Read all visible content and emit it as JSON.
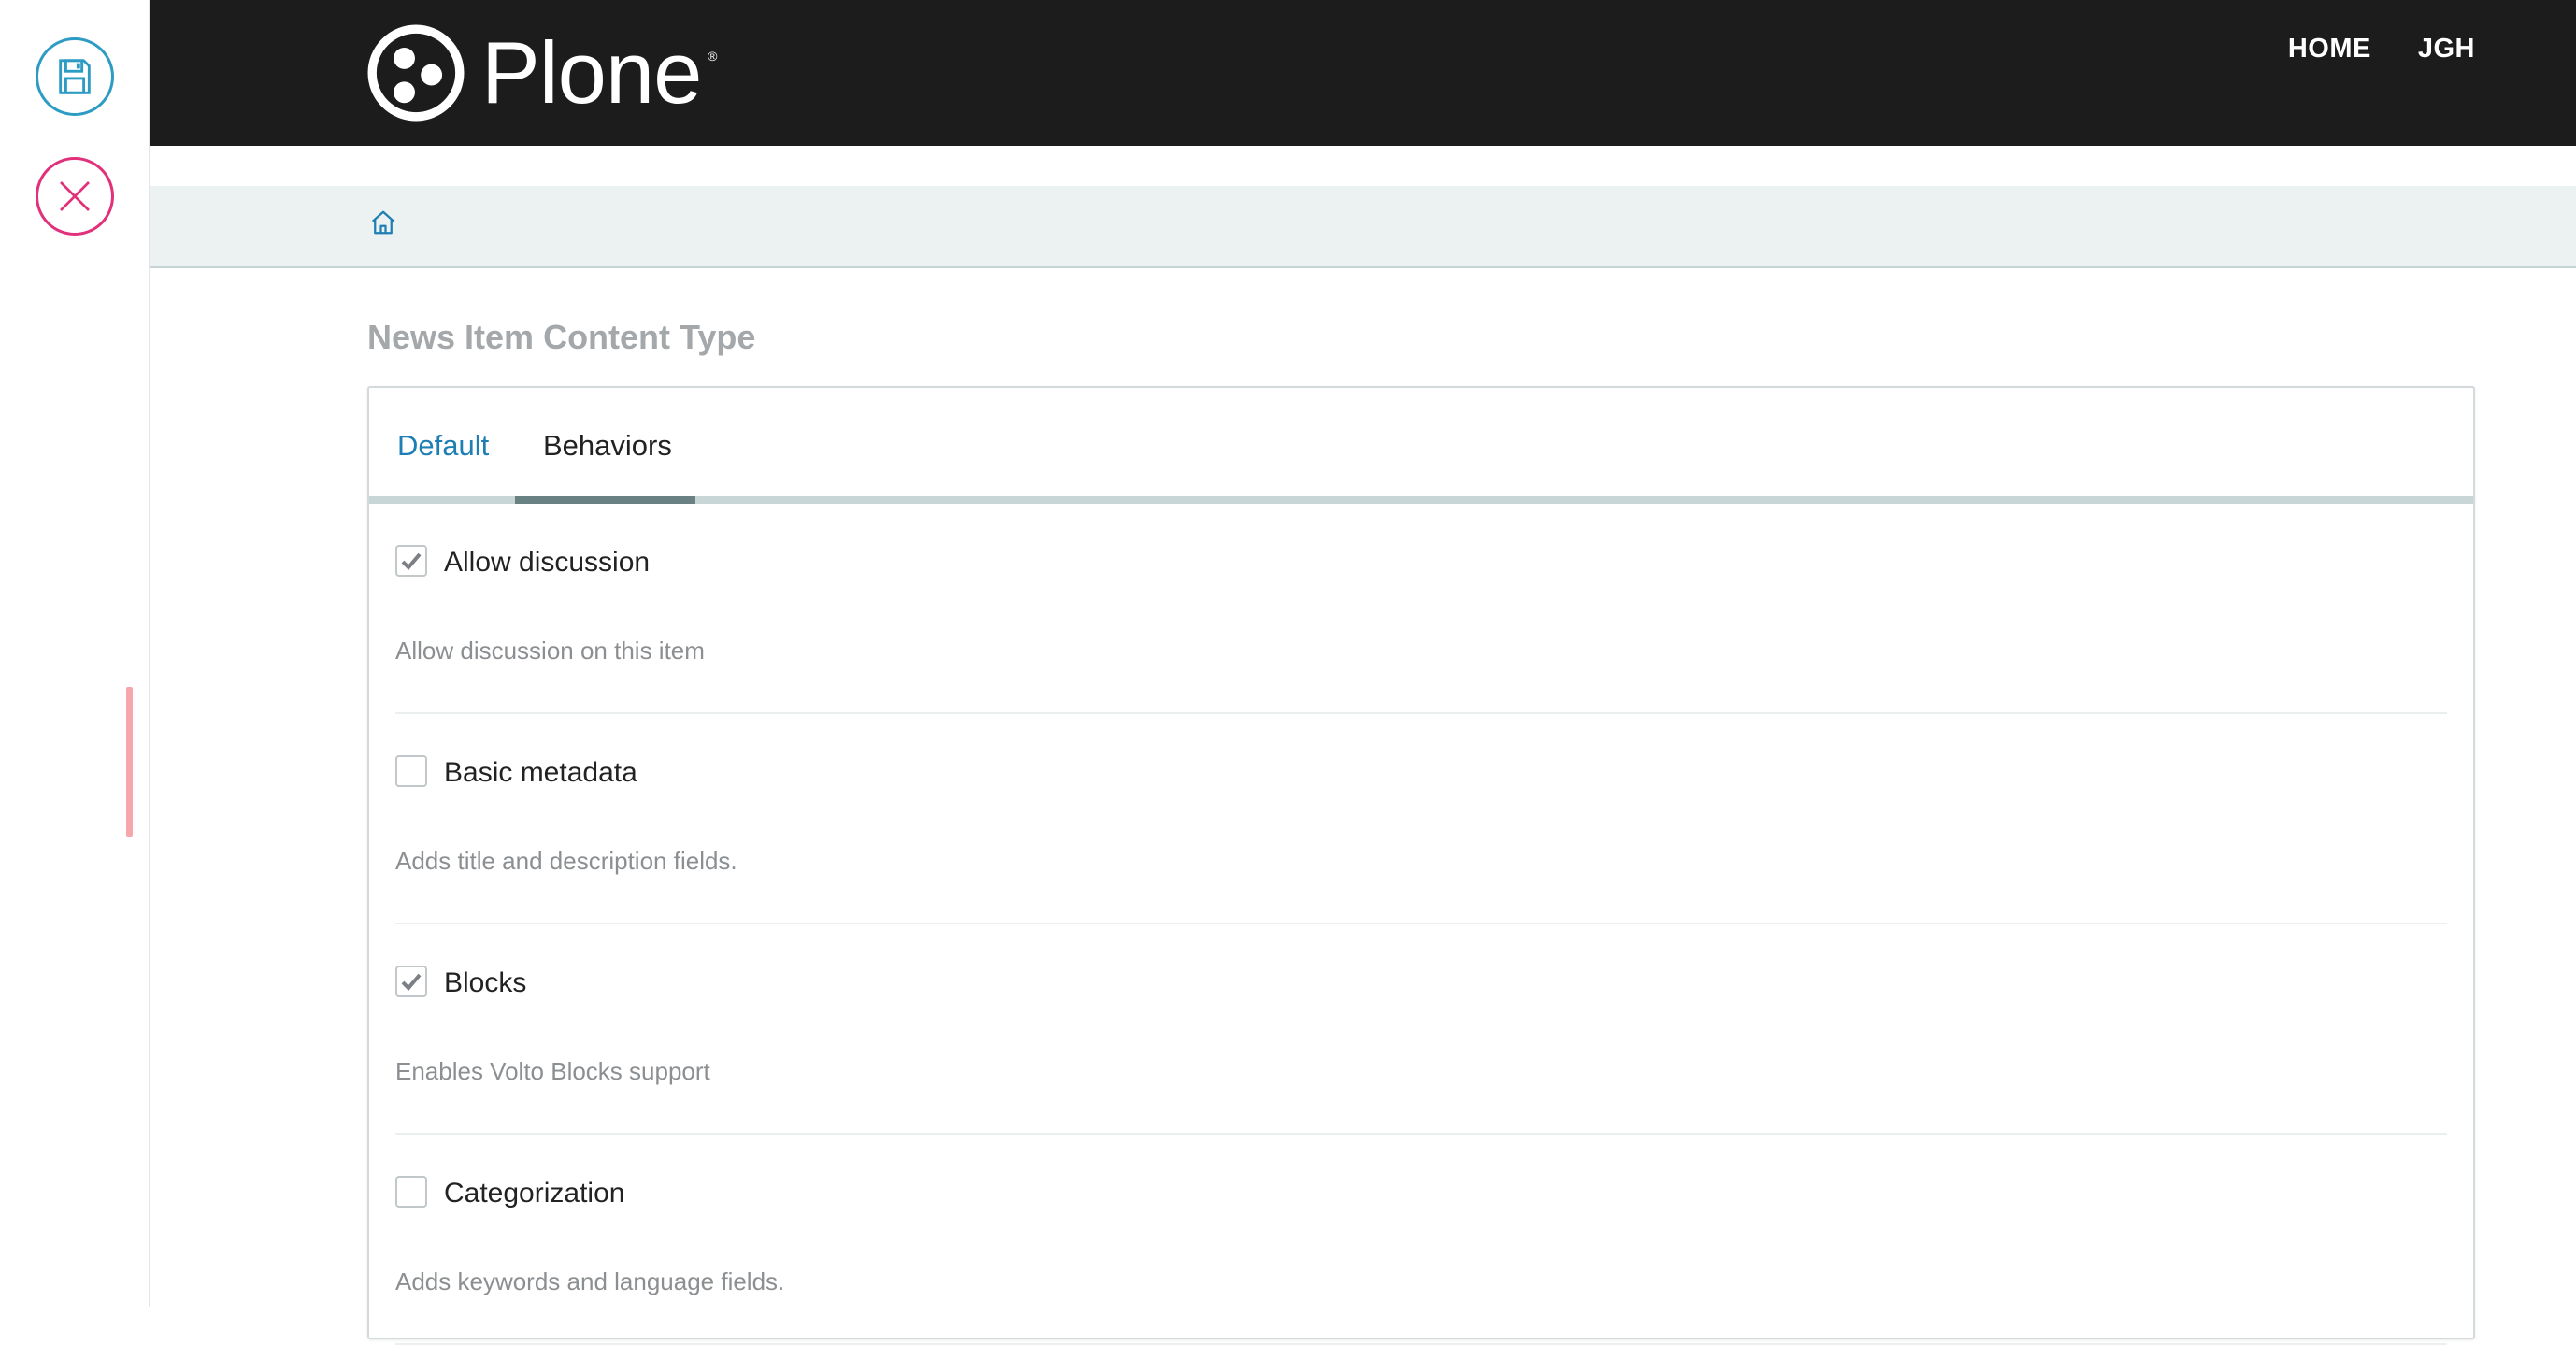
{
  "toolbar": {
    "save_icon": "floppy-disk-icon",
    "cancel_icon": "close-icon",
    "save_color": "#2d9cc4",
    "cancel_color": "#e0317a"
  },
  "header": {
    "logo_text": "Plone",
    "logo_registered": "®",
    "nav": [
      "HOME",
      "JGH"
    ]
  },
  "breadcrumbs": {
    "home_icon": "home-icon"
  },
  "page": {
    "title": "News Item Content Type"
  },
  "tabs": [
    {
      "label": "Default",
      "active": false
    },
    {
      "label": "Behaviors",
      "active": true
    }
  ],
  "behaviors": [
    {
      "label": "Allow discussion",
      "help": "Allow discussion on this item",
      "checked": true
    },
    {
      "label": "Basic metadata",
      "help": "Adds title and description fields.",
      "checked": false
    },
    {
      "label": "Blocks",
      "help": "Enables Volto Blocks support",
      "checked": true
    },
    {
      "label": "Categorization",
      "help": "Adds keywords and language fields.",
      "checked": false
    }
  ],
  "colors": {
    "header_bg": "#1c1c1c",
    "link": "#1f7fb4",
    "breadcrumb_bg": "#ecf1f1"
  }
}
